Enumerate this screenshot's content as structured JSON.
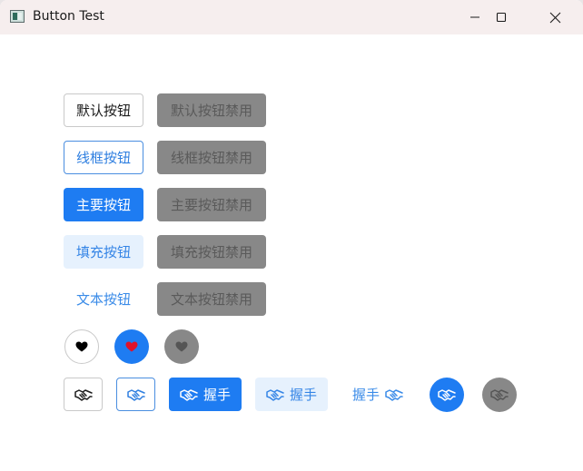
{
  "window": {
    "title": "Button Test",
    "controls": [
      "minimize-icon",
      "maximize-icon",
      "close-icon"
    ]
  },
  "rows": {
    "default": {
      "label": "默认按钮",
      "disabled_label": "默认按钮禁用"
    },
    "outline": {
      "label": "线框按钮",
      "disabled_label": "线框按钮禁用"
    },
    "primary": {
      "label": "主要按钮",
      "disabled_label": "主要按钮禁用"
    },
    "fill": {
      "label": "填充按钮",
      "disabled_label": "填充按钮禁用"
    },
    "text": {
      "label": "文本按钮",
      "disabled_label": "文本按钮禁用"
    }
  },
  "heart_buttons": [
    {
      "style": "default",
      "icon": "heart-icon",
      "color": "#000000"
    },
    {
      "style": "primary",
      "icon": "heart-icon",
      "color": "#e0122a"
    },
    {
      "style": "disabled",
      "icon": "heart-icon",
      "color": "#555555"
    }
  ],
  "handshake_buttons": {
    "icon": "handshake-icon",
    "label": "握手"
  },
  "colors": {
    "primary": "#1e7cf2",
    "fill_bg": "#e6f1fd",
    "disabled_bg": "#888888",
    "text_blue": "#3a8be8"
  }
}
